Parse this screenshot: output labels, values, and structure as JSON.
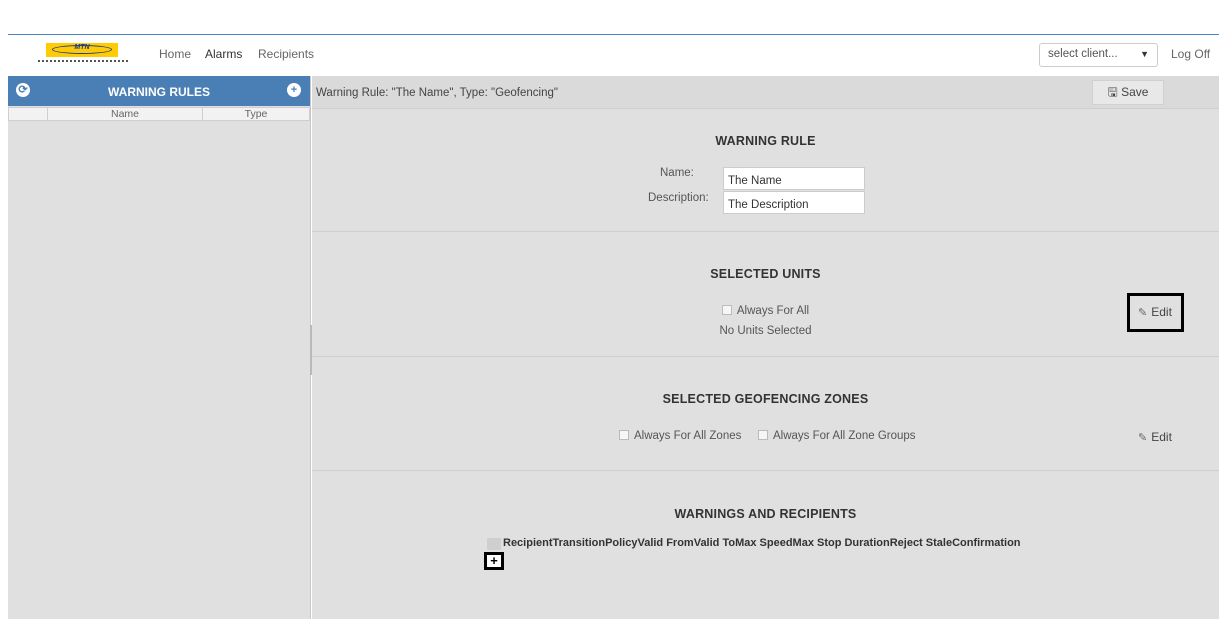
{
  "nav": {
    "home": "Home",
    "alarms": "Alarms",
    "recipients": "Recipients"
  },
  "header": {
    "client_select": "select client...",
    "log_off": "Log Off"
  },
  "logo": {
    "brand": "MTN"
  },
  "sidebar": {
    "title": "WARNING RULES",
    "columns": [
      "Name",
      "Type"
    ]
  },
  "rule_bar": {
    "text": "Warning Rule: \"The Name\", Type: \"Geofencing\"",
    "save_label": "Save"
  },
  "warning_rule": {
    "title": "WARNING RULE",
    "name_label": "Name:",
    "name_value": "The Name",
    "description_label": "Description:",
    "description_value": "The Description"
  },
  "selected_units": {
    "title": "SELECTED UNITS",
    "always_for_all": "Always For All",
    "no_units": "No Units Selected",
    "edit_label": "Edit"
  },
  "geofencing_zones": {
    "title": "SELECTED GEOFENCING ZONES",
    "always_for_all_zones": "Always For All Zones",
    "always_for_all_zone_groups": "Always For All Zone Groups",
    "edit_label": "Edit"
  },
  "warnings_recipients": {
    "title": "WARNINGS AND RECIPIENTS",
    "columns_text": "RecipientTransitionPolicyValid FromValid ToMax SpeedMax Stop DurationReject StaleConfirmation",
    "add_label": "+"
  },
  "colors": {
    "accent": "#4a7fb5",
    "brand_yellow": "#ffcb05",
    "panel_bg": "#e0e0e0"
  }
}
